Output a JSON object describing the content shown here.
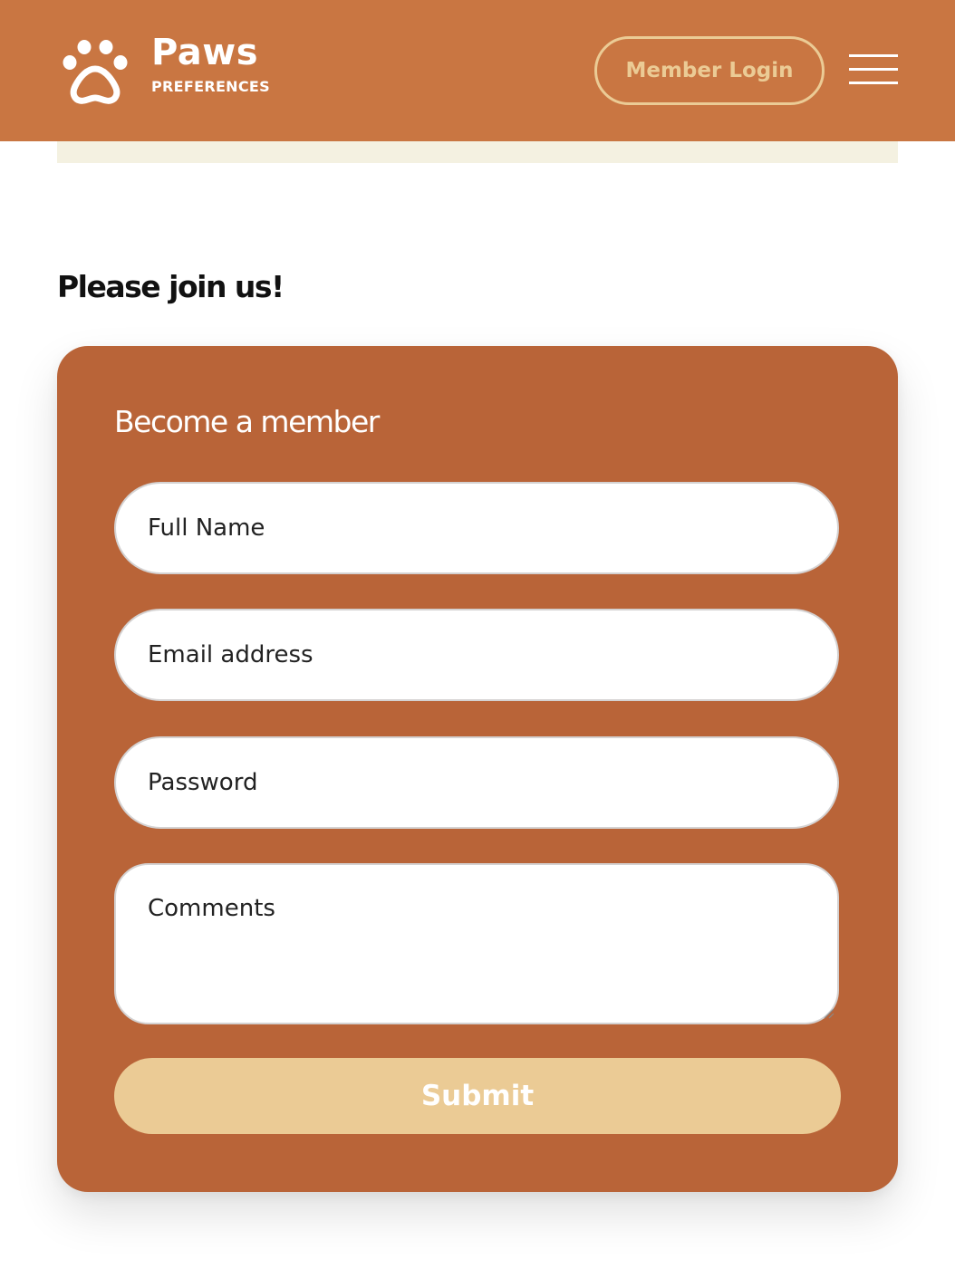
{
  "header": {
    "brand_name": "Paws",
    "brand_sub": "PREFERENCES",
    "logo_icon": "paw-icon",
    "login_label": "Member Login",
    "menu_icon": "hamburger-menu-icon"
  },
  "main": {
    "heading": "Please join us!"
  },
  "form": {
    "title": "Become a member",
    "full_name_placeholder": "Full Name",
    "email_placeholder": "Email address",
    "password_placeholder": "Password",
    "comments_placeholder": "Comments",
    "submit_label": "Submit"
  },
  "colors": {
    "header_bg": "#C97642",
    "card_bg": "#B96438",
    "accent": "#EBCB95",
    "strip": "#F4F1E1"
  }
}
